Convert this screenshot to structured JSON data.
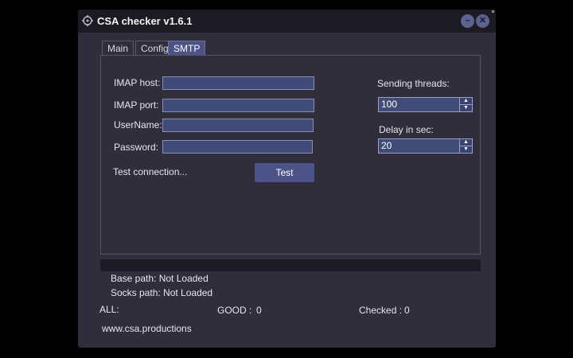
{
  "window": {
    "title": "CSA checker v1.6.1",
    "minimize_label": "–",
    "close_label": "✕"
  },
  "tabs": [
    {
      "label": "Main",
      "active": false
    },
    {
      "label": "Config",
      "active": false
    },
    {
      "label": "SMTP",
      "active": true
    }
  ],
  "smtp": {
    "imap_host": {
      "label": "IMAP host:",
      "value": ""
    },
    "imap_port": {
      "label": "IMAP port:",
      "value": ""
    },
    "username": {
      "label": "UserName:",
      "value": ""
    },
    "password": {
      "label": "Password:",
      "value": ""
    },
    "test_connection_label": "Test connection...",
    "test_button_label": "Test"
  },
  "settings": {
    "sending_threads": {
      "label": "Sending threads:",
      "value": "100"
    },
    "delay": {
      "label": "Delay in sec:",
      "value": "20"
    }
  },
  "progress": {
    "fraction": 0
  },
  "status": {
    "base_path": "Base path: Not Loaded",
    "socks_path": "Socks path: Not Loaded",
    "all_label": "ALL:",
    "good_label": "GOOD :",
    "good_value": "0",
    "checked_label": "Checked :",
    "checked_value": "0"
  },
  "footer": {
    "website": "www.csa.productions"
  },
  "colors": {
    "accent": "#4b5388",
    "field_bg": "#414b78",
    "window_bg": "#2f2e3a",
    "titlebar_bg": "#1c1b23"
  },
  "icons": {
    "app": "crosshair-icon",
    "minimize": "minimize-icon",
    "close": "close-icon"
  }
}
